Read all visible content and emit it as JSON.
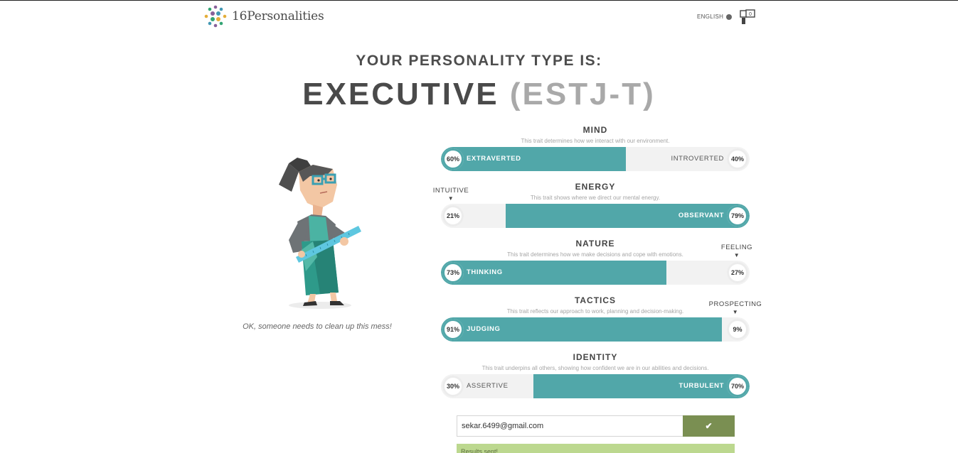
{
  "header": {
    "logo_text": "16Personalities",
    "language_label": "ENGLISH",
    "profile_count": "0"
  },
  "result": {
    "subtitle": "YOUR PERSONALITY TYPE IS:",
    "type_name": "EXECUTIVE",
    "type_code": "(ESTJ-T)",
    "quote": "OK, someone needs to clean up this mess!"
  },
  "traits": [
    {
      "title": "MIND",
      "description": "This trait determines how we interact with our environment.",
      "left_label": "EXTRAVERTED",
      "left_pct": "60%",
      "right_label": "INTROVERTED",
      "right_pct": "40%",
      "dominant": "left",
      "fill_fraction": 0.6,
      "side_tag": ""
    },
    {
      "title": "ENERGY",
      "description": "This trait shows where we direct our mental energy.",
      "left_label": "",
      "left_pct": "21%",
      "right_label": "OBSERVANT",
      "right_pct": "79%",
      "dominant": "right",
      "fill_fraction": 0.79,
      "side_tag": "INTUITIVE"
    },
    {
      "title": "NATURE",
      "description": "This trait determines how we make decisions and cope with emotions.",
      "left_label": "THINKING",
      "left_pct": "73%",
      "right_label": "",
      "right_pct": "27%",
      "dominant": "left",
      "fill_fraction": 0.73,
      "side_tag": "FEELING"
    },
    {
      "title": "TACTICS",
      "description": "This trait reflects our approach to work, planning and decision-making.",
      "left_label": "JUDGING",
      "left_pct": "91%",
      "right_label": "",
      "right_pct": "9%",
      "dominant": "left",
      "fill_fraction": 0.91,
      "side_tag": "PROSPECTING"
    },
    {
      "title": "IDENTITY",
      "description": "This trait underpins all others, showing how confident we are in our abilities and decisions.",
      "left_label": "ASSERTIVE",
      "left_pct": "30%",
      "right_label": "TURBULENT",
      "right_pct": "70%",
      "dominant": "right",
      "fill_fraction": 0.7,
      "side_tag": ""
    }
  ],
  "email": {
    "value": "sekar.6499@gmail.com",
    "notice": "Results sent!"
  },
  "colors": {
    "accent": "#51a7a9",
    "track": "#f2f2f2",
    "button": "#7a8f52",
    "notice_bg": "#bcd88f"
  }
}
